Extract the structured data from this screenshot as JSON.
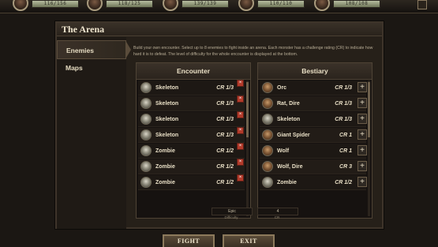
{
  "party": [
    {
      "hp": "116/156"
    },
    {
      "hp": "118/125"
    },
    {
      "hp": "139/139"
    },
    {
      "hp": "110/110"
    },
    {
      "hp": "108/108"
    }
  ],
  "panel": {
    "title": "The Arena",
    "nav": [
      "Enemies",
      "Maps"
    ],
    "description": "Build your own encounter. Select up to 8 enemies to fight inside an arena. Each monster has a challenge rating (CR) to indicate how hard it is to defeat. The level of difficulty for the whole encounter is displayed at the bottom."
  },
  "encounter": {
    "header": "Encounter",
    "rows": [
      {
        "name": "Skeleton",
        "cr": "CR 1/3",
        "icon": "skeleton-icon"
      },
      {
        "name": "Skeleton",
        "cr": "CR 1/3",
        "icon": "skeleton-icon"
      },
      {
        "name": "Skeleton",
        "cr": "CR 1/3",
        "icon": "skeleton-icon"
      },
      {
        "name": "Skeleton",
        "cr": "CR 1/3",
        "icon": "skeleton-icon"
      },
      {
        "name": "Zombie",
        "cr": "CR 1/2",
        "icon": "zombie-icon"
      },
      {
        "name": "Zombie",
        "cr": "CR 1/2",
        "icon": "zombie-icon"
      },
      {
        "name": "Zombie",
        "cr": "CR 1/2",
        "icon": "zombie-icon"
      }
    ]
  },
  "bestiary": {
    "header": "Bestiary",
    "rows": [
      {
        "name": "Orc",
        "cr": "CR 1/3",
        "icon": "orc-icon"
      },
      {
        "name": "Rat, Dire",
        "cr": "CR 1/3",
        "icon": "rat-icon"
      },
      {
        "name": "Skeleton",
        "cr": "CR 1/3",
        "icon": "skeleton-icon"
      },
      {
        "name": "Giant Spider",
        "cr": "CR 1",
        "icon": "spider-icon"
      },
      {
        "name": "Wolf",
        "cr": "CR 1",
        "icon": "wolf-icon"
      },
      {
        "name": "Wolf, Dire",
        "cr": "CR 3",
        "icon": "wolf-icon"
      },
      {
        "name": "Zombie",
        "cr": "CR 1/2",
        "icon": "zombie-icon"
      }
    ]
  },
  "summary": {
    "difficulty_value": "Epic",
    "difficulty_label": "Difficulty",
    "cr_value": "4",
    "cr_label": "CR"
  },
  "actions": {
    "fight": "FIGHT",
    "exit": "EXIT"
  },
  "colors": {
    "remove": "#b23a2a",
    "accent": "#8c7a5c"
  }
}
